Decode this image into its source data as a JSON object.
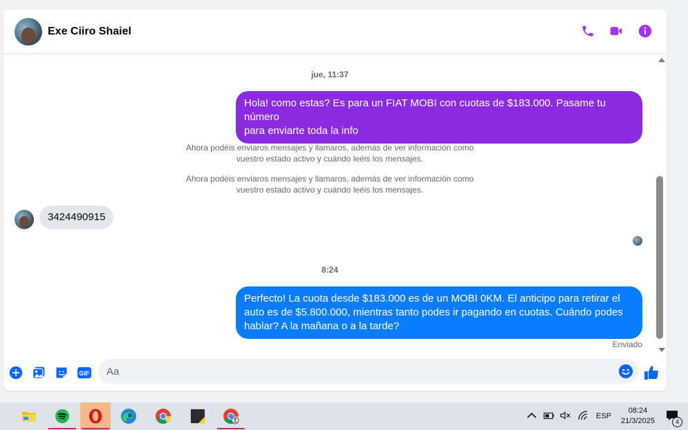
{
  "header": {
    "contact_name": "Exe Ciiro Shaiel"
  },
  "messages": [
    {
      "type": "timestamp",
      "text": "jue, 11:37"
    },
    {
      "type": "outgoing",
      "color": "#8a2be2",
      "lines": [
        "Hola! como estas? Es para un FIAT MOBI con cuotas de $183.000. Pasame tu número",
        "para enviarte toda la info"
      ]
    },
    {
      "type": "system",
      "lines": [
        "Ahora podéis enviaros mensajes y llamaros, además de ver información como",
        "vuestro estado activo y cuándo leéis los mensajes."
      ]
    },
    {
      "type": "system",
      "lines": [
        "Ahora podéis enviaros mensajes y llamaros, además de ver información como",
        "vuestro estado activo y cuándo leéis los mensajes."
      ]
    },
    {
      "type": "incoming",
      "text": "3424490915"
    },
    {
      "type": "timestamp",
      "text": "8:24"
    },
    {
      "type": "outgoing",
      "color": "#0a7cff",
      "lines": [
        "Perfecto! La cuota desde $183.000 es de un MOBI 0KM. El anticipo para retirar el",
        "auto es de $5.800.000, mientras tanto podes ir pagando en cuotas. Cuándo podes",
        "hablar? A la mañana o a la tarde?"
      ]
    }
  ],
  "status": {
    "sent": "Enviado"
  },
  "composer": {
    "placeholder": "Aa",
    "gif_label": "GIF"
  },
  "taskbar": {
    "language": "ESP",
    "time": "08:24",
    "date": "21/3/2025",
    "notifications": "4"
  },
  "colors": {
    "accent_purple": "#a033ff",
    "accent_blue": "#0866ff",
    "bubble_purple": "#8a2be2",
    "bubble_blue": "#0a7cff"
  }
}
